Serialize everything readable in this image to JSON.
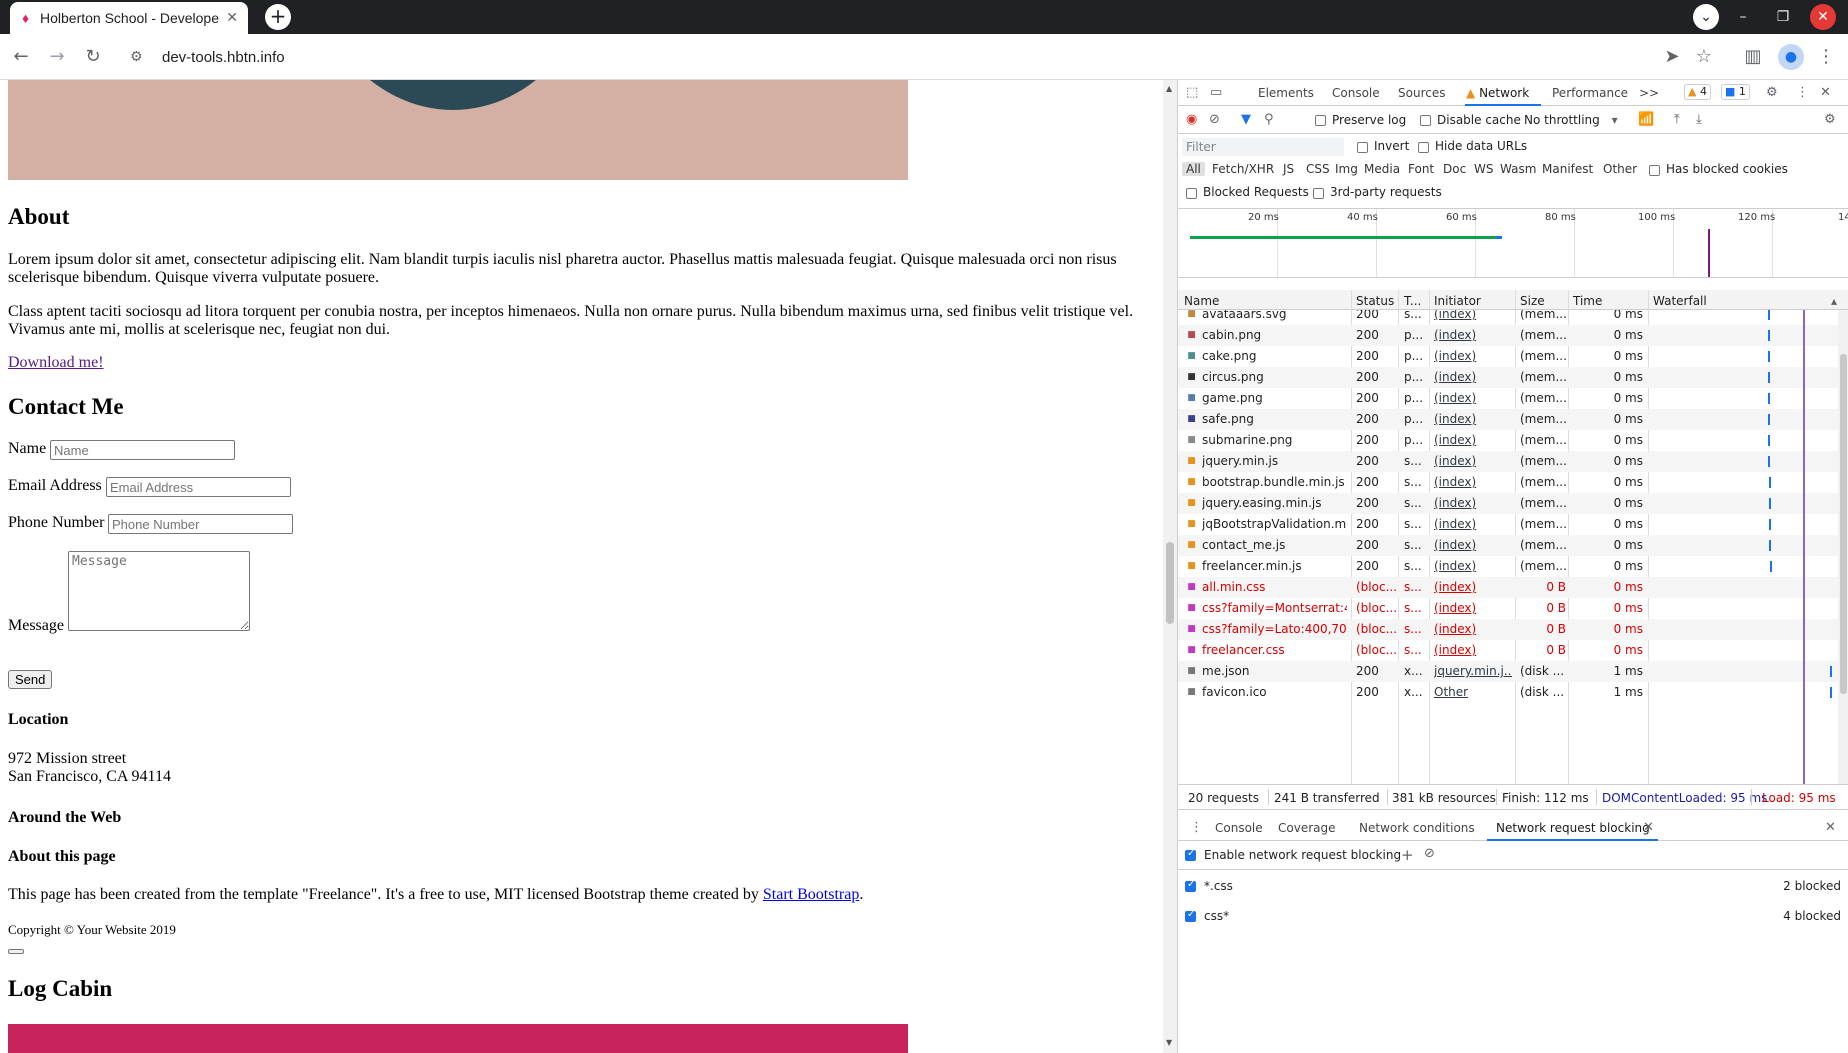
{
  "browser": {
    "tab_title": "Holberton School - Developer",
    "url": "dev-tools.hbtn.info",
    "icons": [
      "favicon-icon",
      "close-icon",
      "plus-icon",
      "chevron-down-icon",
      "minimize-icon",
      "maximize-icon",
      "close-window-icon",
      "back-icon",
      "forward-icon",
      "reload-icon",
      "site-info-icon",
      "send-icon",
      "star-icon",
      "sidepanel-icon",
      "profile-icon",
      "menu-icon"
    ]
  },
  "page": {
    "about_heading": "About",
    "about_p1": "Lorem ipsum dolor sit amet, consectetur adipiscing elit. Nam blandit turpis iaculis nisl pharetra auctor. Phasellus mattis malesuada feugiat. Quisque malesuada orci non risus scelerisque bibendum. Quisque viverra vulputate posuere.",
    "about_p2": "Class aptent taciti sociosqu ad litora torquent per conubia nostra, per inceptos himenaeos. Nulla non ornare purus. Nulla bibendum maximus urna, sed finibus velit tristique vel. Vivamus ante mi, mollis at scelerisque nec, feugiat non dui.",
    "download_link": "Download me!",
    "contact_heading": "Contact Me",
    "name_label": "Name",
    "name_placeholder": "Name",
    "email_label": "Email Address",
    "email_placeholder": "Email Address",
    "phone_label": "Phone Number",
    "phone_placeholder": "Phone Number",
    "message_label": "Message",
    "message_placeholder": "Message",
    "send_button": "Send",
    "location_heading": "Location",
    "address_line1": "972 Mission street",
    "address_line2": "San Francisco, CA 94114",
    "around_heading": "Around the Web",
    "about_page_heading": "About this page",
    "about_page_text": "This page has been created from the template \"Freelance\". It's a free to use, MIT licensed Bootstrap theme created by ",
    "start_bootstrap_link": "Start Bootstrap",
    "about_page_period": ".",
    "copyright": "Copyright © Your Website 2019",
    "log_cabin_heading": "Log Cabin"
  },
  "devtools": {
    "tabs": [
      "Elements",
      "Console",
      "Sources",
      "Network",
      "Performance"
    ],
    "more_tabs": ">>",
    "warnings_count": "4",
    "messages_count": "1",
    "preserve_log": "Preserve log",
    "disable_cache": "Disable cache",
    "throttling": "No throttling",
    "filter_placeholder": "Filter",
    "invert": "Invert",
    "hide_data_urls": "Hide data URLs",
    "types": [
      "All",
      "Fetch/XHR",
      "JS",
      "CSS",
      "Img",
      "Media",
      "Font",
      "Doc",
      "WS",
      "Wasm",
      "Manifest",
      "Other"
    ],
    "has_blocked_cookies": "Has blocked cookies",
    "blocked_requests": "Blocked Requests",
    "third_party": "3rd-party requests",
    "overview_ticks": [
      "20 ms",
      "40 ms",
      "60 ms",
      "80 ms",
      "100 ms",
      "120 ms",
      "14"
    ],
    "columns": [
      "Name",
      "Status",
      "T...",
      "Initiator",
      "Size",
      "Time",
      "Waterfall"
    ],
    "requests": [
      {
        "name": "avataaars.svg",
        "status": "200",
        "type": "s...",
        "initiator": "(index)",
        "size": "(mem...",
        "time": "0 ms",
        "icon": "svg-icon",
        "icolor": "#c08a3e",
        "blocked": false
      },
      {
        "name": "cabin.png",
        "status": "200",
        "type": "p...",
        "initiator": "(index)",
        "size": "(mem...",
        "time": "0 ms",
        "icon": "image-icon",
        "icolor": "#b5484e",
        "blocked": false
      },
      {
        "name": "cake.png",
        "status": "200",
        "type": "p...",
        "initiator": "(index)",
        "size": "(mem...",
        "time": "0 ms",
        "icon": "image-icon",
        "icolor": "#4d8e8e",
        "blocked": false
      },
      {
        "name": "circus.png",
        "status": "200",
        "type": "p...",
        "initiator": "(index)",
        "size": "(mem...",
        "time": "0 ms",
        "icon": "image-icon",
        "icolor": "#333333",
        "blocked": false
      },
      {
        "name": "game.png",
        "status": "200",
        "type": "p...",
        "initiator": "(index)",
        "size": "(mem...",
        "time": "0 ms",
        "icon": "image-icon",
        "icolor": "#5a7bb0",
        "blocked": false
      },
      {
        "name": "safe.png",
        "status": "200",
        "type": "p...",
        "initiator": "(index)",
        "size": "(mem...",
        "time": "0 ms",
        "icon": "image-icon",
        "icolor": "#3b3f8f",
        "blocked": false
      },
      {
        "name": "submarine.png",
        "status": "200",
        "type": "p...",
        "initiator": "(index)",
        "size": "(mem...",
        "time": "0 ms",
        "icon": "image-icon",
        "icolor": "#8a8a8a",
        "blocked": false
      },
      {
        "name": "jquery.min.js",
        "status": "200",
        "type": "s...",
        "initiator": "(index)",
        "size": "(mem...",
        "time": "0 ms",
        "icon": "script-icon",
        "icolor": "#e8911c",
        "blocked": false
      },
      {
        "name": "bootstrap.bundle.min.js",
        "status": "200",
        "type": "s...",
        "initiator": "(index)",
        "size": "(mem...",
        "time": "0 ms",
        "icon": "script-icon",
        "icolor": "#e8911c",
        "blocked": false
      },
      {
        "name": "jquery.easing.min.js",
        "status": "200",
        "type": "s...",
        "initiator": "(index)",
        "size": "(mem...",
        "time": "0 ms",
        "icon": "script-icon",
        "icolor": "#e8911c",
        "blocked": false
      },
      {
        "name": "jqBootstrapValidation.m...",
        "status": "200",
        "type": "s...",
        "initiator": "(index)",
        "size": "(mem...",
        "time": "0 ms",
        "icon": "script-icon",
        "icolor": "#e8911c",
        "blocked": false
      },
      {
        "name": "contact_me.js",
        "status": "200",
        "type": "s...",
        "initiator": "(index)",
        "size": "(mem...",
        "time": "0 ms",
        "icon": "script-icon",
        "icolor": "#e8911c",
        "blocked": false
      },
      {
        "name": "freelancer.min.js",
        "status": "200",
        "type": "s...",
        "initiator": "(index)",
        "size": "(mem...",
        "time": "0 ms",
        "icon": "script-icon",
        "icolor": "#e8911c",
        "blocked": false
      },
      {
        "name": "all.min.css",
        "status": "(bloc...",
        "type": "s...",
        "initiator": "(index)",
        "size": "0 B",
        "time": "0 ms",
        "icon": "stylesheet-icon",
        "icolor": "#c238c2",
        "blocked": true
      },
      {
        "name": "css?family=Montserrat:4...",
        "status": "(bloc...",
        "type": "s...",
        "initiator": "(index)",
        "size": "0 B",
        "time": "0 ms",
        "icon": "stylesheet-icon",
        "icolor": "#c238c2",
        "blocked": true
      },
      {
        "name": "css?family=Lato:400,700...",
        "status": "(bloc...",
        "type": "s...",
        "initiator": "(index)",
        "size": "0 B",
        "time": "0 ms",
        "icon": "stylesheet-icon",
        "icolor": "#c238c2",
        "blocked": true
      },
      {
        "name": "freelancer.css",
        "status": "(bloc...",
        "type": "s...",
        "initiator": "(index)",
        "size": "0 B",
        "time": "0 ms",
        "icon": "stylesheet-icon",
        "icolor": "#c238c2",
        "blocked": true
      },
      {
        "name": "me.json",
        "status": "200",
        "type": "x...",
        "initiator": "jquery.min.j...",
        "size": "(disk ...",
        "time": "1 ms",
        "icon": "document-icon",
        "icolor": "#777777",
        "blocked": false
      },
      {
        "name": "favicon.ico",
        "status": "200",
        "type": "x...",
        "initiator": "Other",
        "size": "(disk ...",
        "time": "1 ms",
        "icon": "document-icon",
        "icolor": "#777777",
        "blocked": false
      }
    ],
    "summary": {
      "requests": "20 requests",
      "transferred": "241 B transferred",
      "resources": "381 kB resources",
      "finish": "Finish: 112 ms",
      "dcl": "DOMContentLoaded: 95 ms",
      "load": "Load: 95 ms"
    },
    "drawer_tabs": [
      "Console",
      "Coverage",
      "Network conditions",
      "Network request blocking"
    ],
    "enable_blocking": "Enable network request blocking",
    "patterns": [
      {
        "pattern": "*.css",
        "count": "2 blocked"
      },
      {
        "pattern": "css*",
        "count": "4 blocked"
      }
    ],
    "colors": {
      "accent": "#1a73e8",
      "blocked": "#d50000",
      "dcl": "#1a1aa6",
      "load": "#d50000"
    }
  }
}
